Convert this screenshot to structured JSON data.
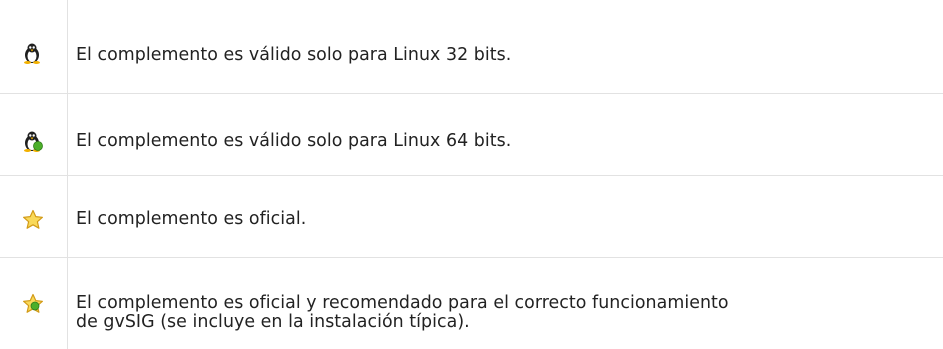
{
  "legend": {
    "rows": [
      {
        "icon": "linux-32-icon",
        "text": "El complemento es válido solo para Linux 32 bits."
      },
      {
        "icon": "linux-64-icon",
        "text": "El complemento es válido solo para Linux 64 bits."
      },
      {
        "icon": "star-official-icon",
        "text": "El complemento es oficial."
      },
      {
        "icon": "star-recommended-icon",
        "line1": "El complemento es oficial y recomendado para el correcto funcionamiento",
        "line2": "de gvSIG (se incluye en la instalación típica)."
      }
    ]
  },
  "colors": {
    "divider": "#e2e2e2",
    "text": "#222222",
    "tux_body": "#1f1f1f",
    "tux_beak": "#f2b100",
    "star_fill": "#f9d95a",
    "star_stroke": "#d29b18",
    "badge_green": "#4caf2a"
  }
}
